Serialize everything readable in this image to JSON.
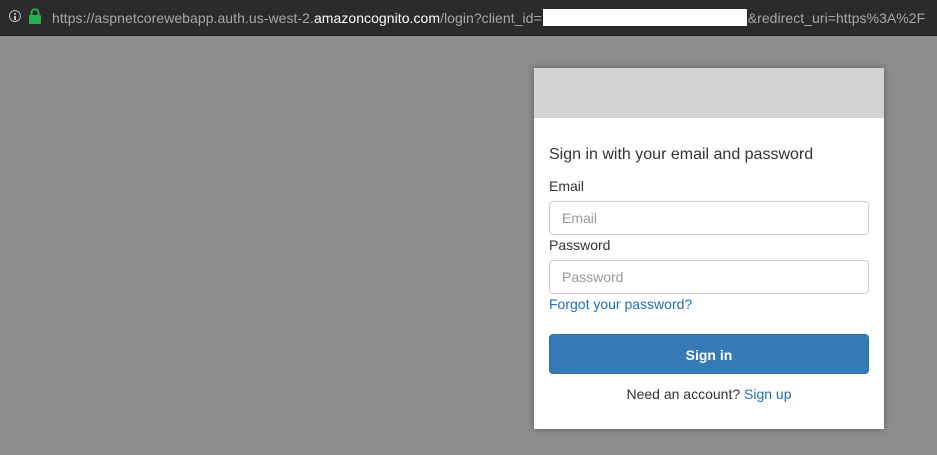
{
  "browser": {
    "url_scheme_prefix": "https://aspnetcorewebapp.auth.us-west-2.",
    "url_host": "amazoncognito.com",
    "url_path": "/login?client_id=",
    "url_suffix": "&redirect_uri=https%3A%2F",
    "lock_color": "#22b14c"
  },
  "login": {
    "heading": "Sign in with your email and password",
    "email_label": "Email",
    "email_placeholder": "Email",
    "password_label": "Password",
    "password_placeholder": "Password",
    "forgot_link": "Forgot your password?",
    "signin_button": "Sign in",
    "signup_prompt": "Need an account?",
    "signup_link": "Sign up"
  },
  "colors": {
    "backdrop": "#8c8c8c",
    "banner": "#d3d3d3",
    "primary_button": "#337ab7",
    "link": "#1f6fb5"
  }
}
